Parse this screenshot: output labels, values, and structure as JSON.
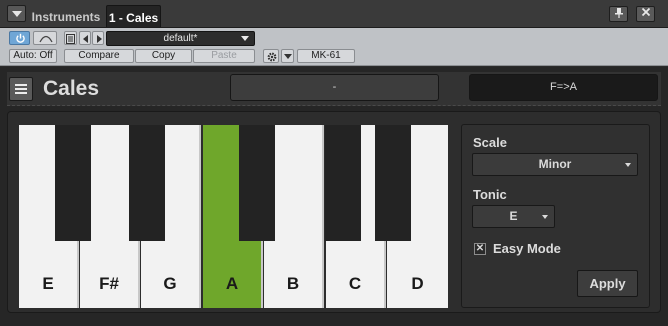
{
  "window": {
    "tabs": [
      {
        "label": "Instruments",
        "active": false
      },
      {
        "label": "1 - Cales",
        "active": true
      }
    ],
    "buttons": {
      "pin_icon": "pin-icon",
      "close_icon": "close-icon"
    }
  },
  "toolbar": {
    "preset": "default*",
    "auto_label": "Auto: Off",
    "compare_label": "Compare",
    "copy_label": "Copy",
    "paste_label": "Paste",
    "device": "MK-61"
  },
  "plugin": {
    "title": "Cales",
    "field_a": "-",
    "field_b": "F=>A",
    "keys": [
      {
        "note": "E",
        "active": false
      },
      {
        "note": "F#",
        "active": false
      },
      {
        "note": "G",
        "active": false
      },
      {
        "note": "A",
        "active": true
      },
      {
        "note": "B",
        "active": false
      },
      {
        "note": "C",
        "active": false
      },
      {
        "note": "D",
        "active": false
      }
    ],
    "scale_label": "Scale",
    "scale_value": "Minor",
    "tonic_label": "Tonic",
    "tonic_value": "E",
    "easy_mode_label": "Easy Mode",
    "easy_mode_checked": true,
    "apply_label": "Apply"
  },
  "colors": {
    "active_key": "#6fa72b",
    "power_on": "#6fa6d6",
    "background": "#262626"
  }
}
